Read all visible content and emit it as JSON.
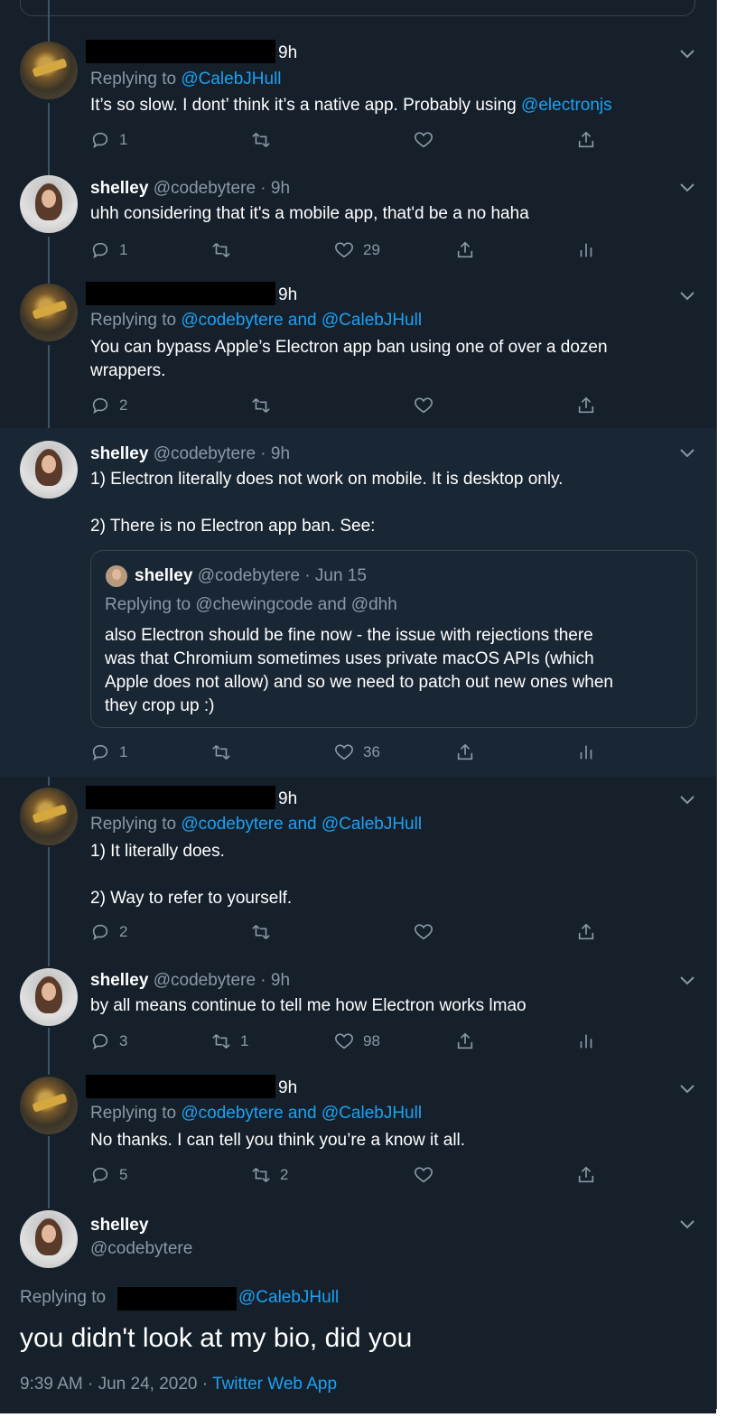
{
  "colors": {
    "background": "#15202b",
    "highlight": "#192734",
    "link": "#1da1f2",
    "muted": "#8899a6",
    "redaction": "#000000"
  },
  "tweets": [
    {
      "time": "9h",
      "replying_prefix": "Replying to ",
      "replying_links": "@CalebJHull",
      "text_before": "It’s so slow. I dont’ think it’s a native app. Probably using ",
      "text_link": "@electronjs",
      "replies": "1",
      "retweets": "",
      "likes": ""
    },
    {
      "name": "shelley",
      "handle_time": "@codebytere · 9h",
      "text": "uhh considering that it's a mobile app, that'd be a no haha",
      "replies": "1",
      "retweets": "",
      "likes": "29"
    },
    {
      "time": "9h",
      "replying_prefix": "Replying to ",
      "replying_links": "@codebytere and @CalebJHull",
      "text": "You can bypass Apple’s Electron app ban using one of over a dozen\nwrappers.",
      "replies": "2",
      "retweets": "",
      "likes": ""
    },
    {
      "name": "shelley",
      "handle_time": "@codebytere · 9h",
      "text": "1) Electron literally does not work on mobile. It is desktop only.\n\n2) There is no Electron app ban. See:",
      "quote": {
        "name": "shelley",
        "handle_date": "@codebytere · Jun 15",
        "replying": "Replying to @chewingcode and @dhh",
        "text": "also Electron should be fine now - the issue with rejections there\nwas that Chromium sometimes uses private macOS APIs (which\nApple does not allow) and so we need to patch out new ones when\nthey crop up :)"
      },
      "replies": "1",
      "retweets": "",
      "likes": "36"
    },
    {
      "time": "9h",
      "replying_prefix": "Replying to ",
      "replying_links": "@codebytere and @CalebJHull",
      "text": "1) It literally does.\n\n2) Way to refer to yourself.",
      "replies": "2",
      "retweets": "",
      "likes": ""
    },
    {
      "name": "shelley",
      "handle_time": "@codebytere · 9h",
      "text": "by all means continue to tell me how Electron works lmao",
      "replies": "3",
      "retweets": "1",
      "likes": "98"
    },
    {
      "time": "9h",
      "replying_prefix": "Replying to ",
      "replying_links": "@codebytere and @CalebJHull",
      "text": "No thanks. I can tell you think you’re a know it all.",
      "replies": "5",
      "retweets": "2",
      "likes": ""
    }
  ],
  "main_tweet": {
    "name": "shelley",
    "handle": "@codebytere",
    "replying_prefix": "Replying to",
    "replying_link": "@CalebJHull",
    "text": "you didn't look at my bio, did you",
    "timestamp": "9:39 AM · Jun 24, 2020 · ",
    "source": "Twitter Web App"
  }
}
